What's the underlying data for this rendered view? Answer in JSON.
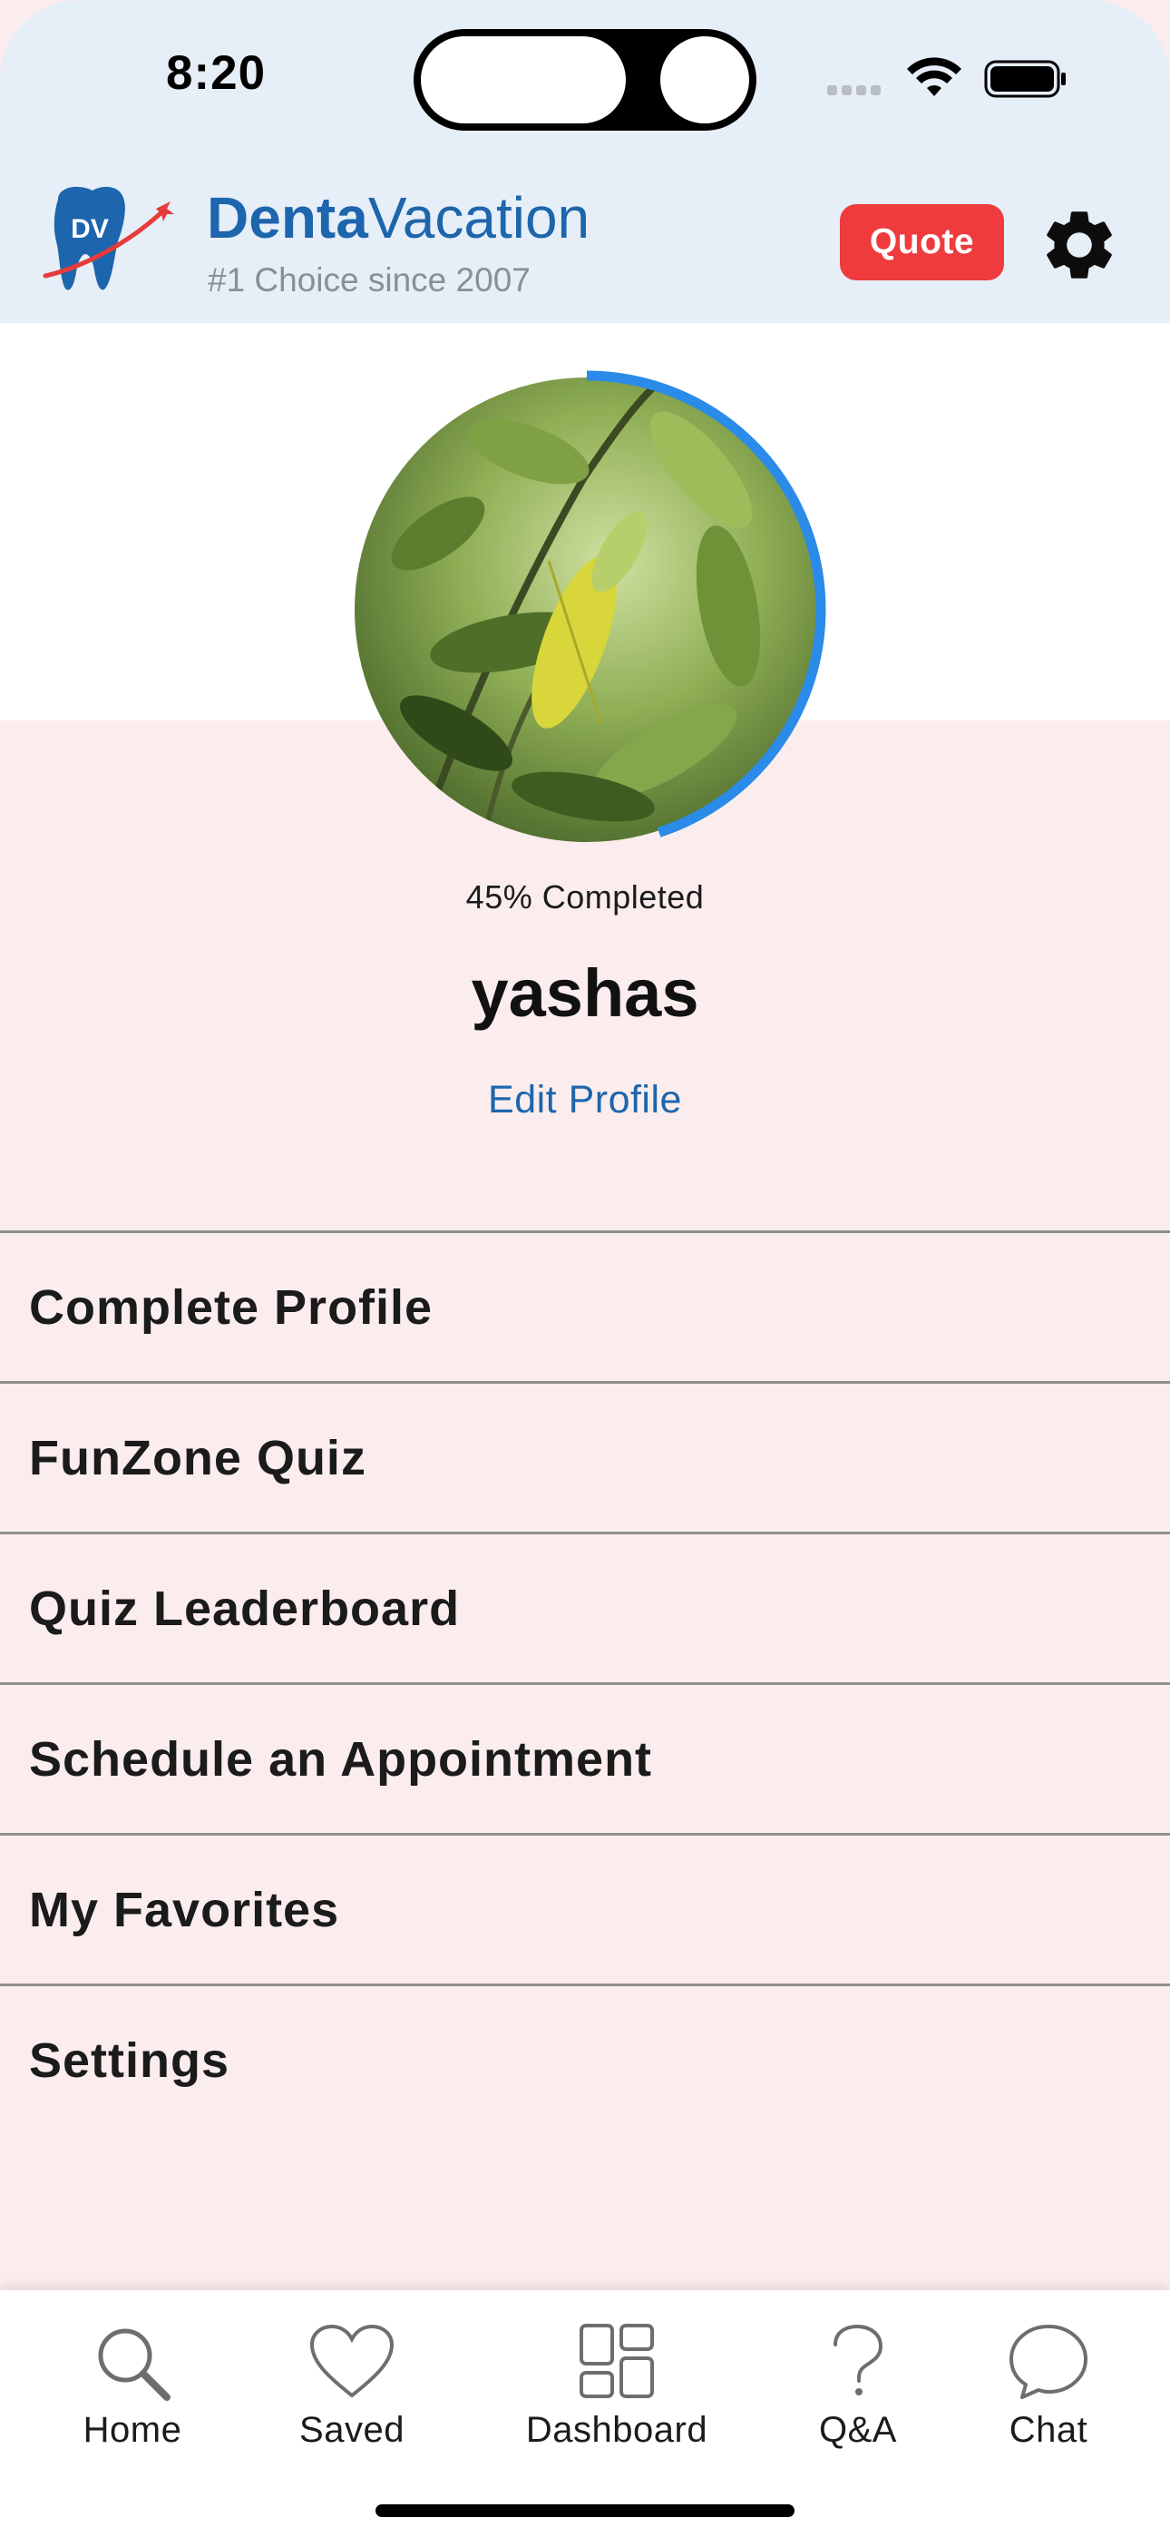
{
  "status_bar": {
    "time": "8:20"
  },
  "app_bar": {
    "brand_bold": "Denta",
    "brand_light": "Vacation",
    "logo_text": "DV",
    "tagline": "#1 Choice since 2007",
    "quote_label": "Quote",
    "settings_icon": "gear-icon"
  },
  "profile": {
    "completion_text": "45% Completed",
    "completion_fraction": 0.45,
    "username": "yashas",
    "edit_label": "Edit Profile"
  },
  "menu": {
    "items": [
      {
        "label": "Complete Profile"
      },
      {
        "label": "FunZone Quiz"
      },
      {
        "label": "Quiz Leaderboard"
      },
      {
        "label": "Schedule an Appointment"
      },
      {
        "label": "My Favorites"
      },
      {
        "label": "Settings"
      }
    ]
  },
  "tabbar": {
    "tabs": [
      {
        "label": "Home",
        "icon": "search-icon"
      },
      {
        "label": "Saved",
        "icon": "heart-icon"
      },
      {
        "label": "Dashboard",
        "icon": "dashboard-icon"
      },
      {
        "label": "Q&A",
        "icon": "question-icon"
      },
      {
        "label": "Chat",
        "icon": "chat-bubble-icon"
      }
    ]
  },
  "colors": {
    "brand_blue": "#1d65ad",
    "quote_red": "#ef3b3d",
    "header_bg": "#e6eef7",
    "page_bg": "#fbeded",
    "progress_blue": "#2a8be8"
  }
}
